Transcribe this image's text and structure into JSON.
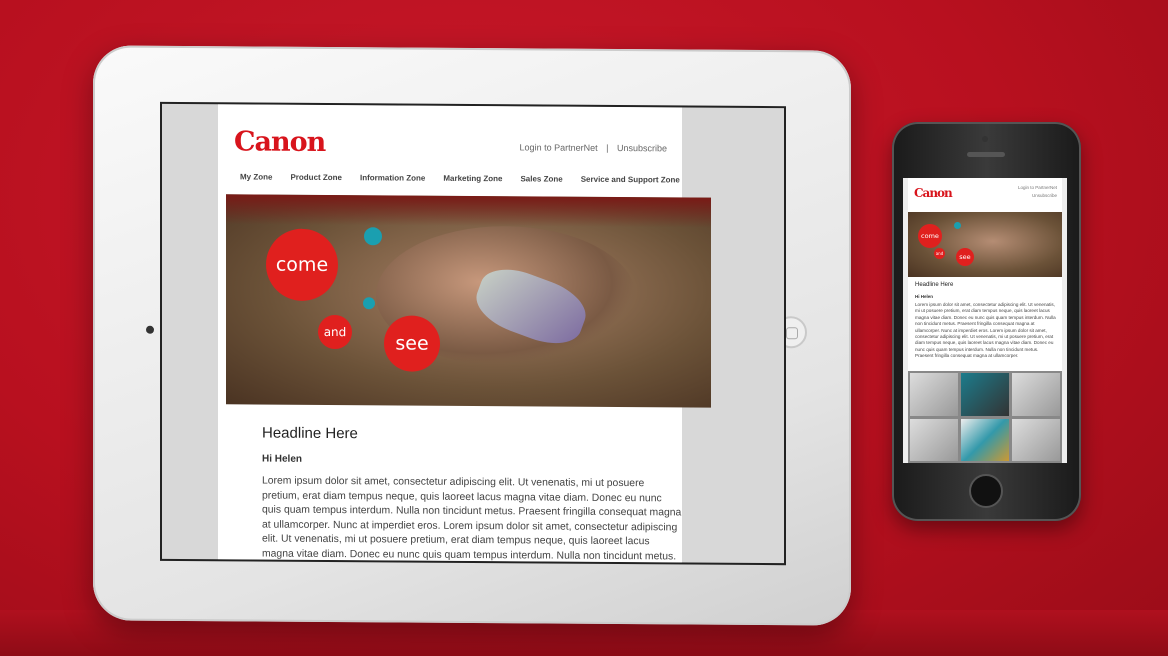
{
  "email": {
    "brand": "Canon",
    "login_link": "Login to PartnerNet",
    "separator": "|",
    "unsubscribe_link": "Unsubscribe",
    "nav": [
      "My Zone",
      "Product Zone",
      "Information Zone",
      "Marketing Zone",
      "Sales Zone",
      "Service and Support Zone"
    ],
    "banner": {
      "word1": "come",
      "word2": "and",
      "word3": "see"
    },
    "headline": "Headline Here",
    "greeting": "Hi Helen",
    "body": "Lorem ipsum dolor sit amet, consectetur adipiscing elit. Ut venenatis, mi ut posuere pretium, erat diam tempus neque, quis laoreet lacus magna vitae diam. Donec eu nunc quis quam tempus interdum. Nulla non tincidunt metus. Praesent fringilla consequat magna at ullamcorper. Nunc at imperdiet eros. Lorem ipsum dolor sit amet, consectetur adipiscing elit. Ut venenatis, mi ut posuere pretium, erat diam tempus neque, quis laoreet lacus magna vitae diam. Donec eu nunc quis quam tempus interdum. Nulla non tincidunt metus. Praesent fringilla consequat magna at ullamcorper."
  },
  "colors": {
    "brand_red": "#d8141c",
    "background": "#b8101f",
    "accent_teal": "#1a9fb0"
  }
}
